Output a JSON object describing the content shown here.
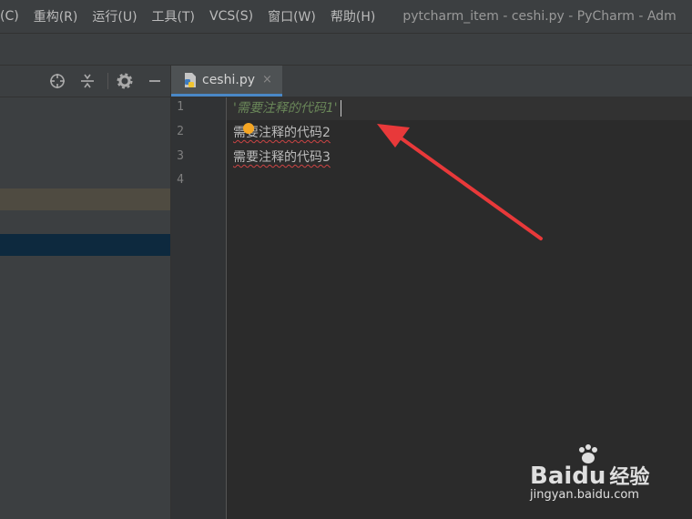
{
  "menu": {
    "items": [
      "(C)",
      "重构(R)",
      "运行(U)",
      "工具(T)",
      "VCS(S)",
      "窗口(W)",
      "帮助(H)"
    ],
    "title": "pytcharm_item - ceshi.py - PyCharm - Adm"
  },
  "tab": {
    "label": "ceshi.py",
    "close": "×"
  },
  "editor": {
    "line_numbers": [
      "1",
      "2",
      "3",
      "4"
    ],
    "lines": [
      "'需要注释的代码1'",
      "需要注释的代码2",
      "需要注释的代码3"
    ]
  },
  "watermark": {
    "brand": "Bai",
    "brand2": "du",
    "brand3": "经验",
    "url": "jingyan.baidu.com"
  },
  "colors": {
    "accent": "#4a88c7",
    "arrow": "#e8393a",
    "string": "#6a8759"
  },
  "icons": [
    "crosshair-icon",
    "collapse-icon",
    "gear-icon",
    "minimize-icon",
    "python-file-icon"
  ]
}
